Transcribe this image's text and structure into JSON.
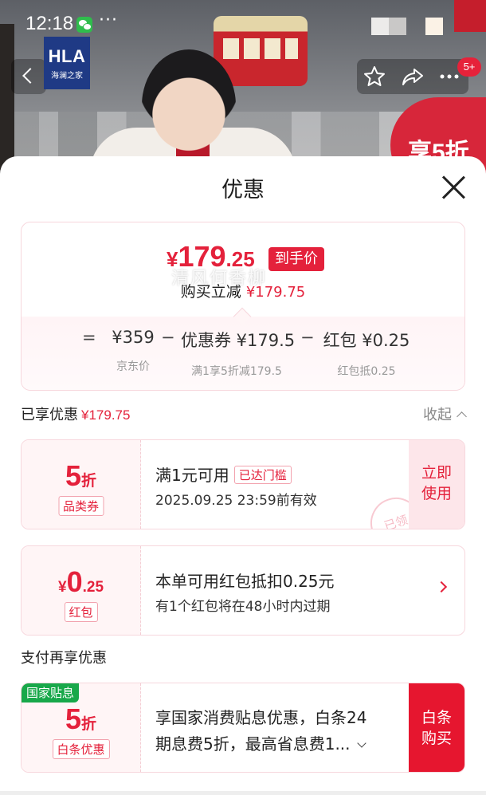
{
  "status_bar": {
    "time": "12:18",
    "dots": "···"
  },
  "header": {
    "brand_main": "HLA",
    "brand_sub": "海澜之家",
    "cart_count": "5+",
    "promo_text": "享5折"
  },
  "sheet": {
    "title": "优惠",
    "final_price": {
      "currency": "¥",
      "integer": "179",
      "decimal": ".25",
      "badge": "到手价"
    },
    "reduce": {
      "label": "购买立减",
      "amount": "¥179.75"
    },
    "formula": {
      "equals": "=",
      "items": [
        {
          "amount": "¥359",
          "caption": "京东价"
        },
        {
          "amount": "优惠券 ¥179.5",
          "caption": "满1享5折减179.5"
        },
        {
          "amount": "红包 ¥0.25",
          "caption": "红包抵0.25"
        }
      ],
      "minus": "−"
    },
    "watermark": "清风何香柳",
    "applied": {
      "label": "已享优惠",
      "amount": "¥179.75",
      "toggle": "收起"
    },
    "coupon": {
      "value": "5",
      "unit": "折",
      "tag": "品类券",
      "title": "满1元可用",
      "threshold": "已达门槛",
      "validity": "2025.09.25 23:59前有效",
      "action_line1": "立即",
      "action_line2": "使用",
      "stamp": "已领"
    },
    "redpacket": {
      "currency": "¥",
      "integer": "0",
      "decimal": ".25",
      "tag": "红包",
      "title": "本单可用红包抵扣0.25元",
      "subtitle": "有1个红包将在48小时内过期"
    },
    "pay_section": {
      "label": "支付再享优惠"
    },
    "baitiao": {
      "corner_label": "国家贴息",
      "value": "5",
      "unit": "折",
      "tag": "白条优惠",
      "line1": "享国家消费贴息优惠，白条24",
      "line2": "期息费5折，最高省息费1...",
      "action_line1": "白条",
      "action_line2": "购买"
    }
  },
  "colors": {
    "accent": "#e4213b",
    "gov_green": "#18a84a",
    "card_border": "#f7d7dd"
  }
}
